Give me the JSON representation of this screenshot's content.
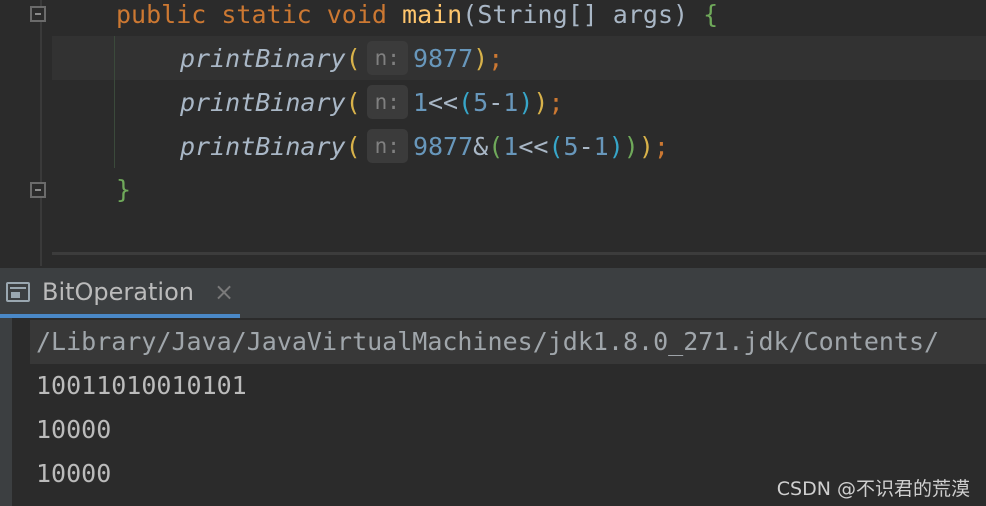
{
  "editor": {
    "line1": {
      "kw1": "public",
      "kw2": "static",
      "kw3": "void",
      "fn": "main",
      "open": "(",
      "type": "String[]",
      "param": "args",
      "close": ")",
      "brace": "{"
    },
    "call_name": "printBinary",
    "hint": "n:",
    "line2": {
      "arg": "9877"
    },
    "line3": {
      "a": "1",
      "op": "<<",
      "b": "5",
      "minus": "-",
      "c": "1"
    },
    "line4": {
      "a": "9877",
      "amp": "&",
      "b": "1",
      "op": "<<",
      "c": "5",
      "minus": "-",
      "d": "1"
    },
    "close_brace": "}"
  },
  "run_tab": {
    "label": "BitOperation",
    "close": "×"
  },
  "console": {
    "command": "/Library/Java/JavaVirtualMachines/jdk1.8.0_271.jdk/Contents/",
    "output": [
      "10011010010101",
      "10000",
      "10000"
    ]
  },
  "watermark": "CSDN @不识君的荒漠",
  "colors": {
    "keyword": "#cc7832",
    "function": "#ffc66d",
    "number": "#6897bb",
    "text": "#a9b7c6",
    "background": "#2b2b2b",
    "tab_underline": "#4a88c7"
  },
  "icons": [
    "fold-icon",
    "console-tab-icon",
    "close-icon"
  ]
}
